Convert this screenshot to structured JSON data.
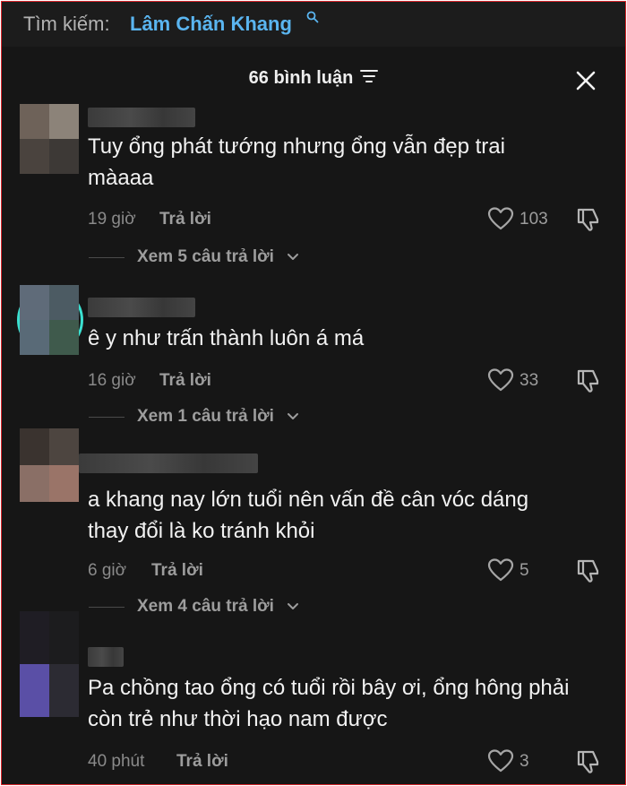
{
  "search": {
    "prefix": "Tìm kiếm:",
    "query": "Lâm Chấn Khang",
    "icon": "search-icon"
  },
  "header": {
    "title": "66 bình luận",
    "filter_icon": "filter-icon",
    "close_icon": "close-icon"
  },
  "colors": {
    "background": "#161616",
    "query": "#5ab5f0",
    "border": "#d9262c"
  },
  "comments": [
    {
      "text": "Tuy ổng phát tướng nhưng ổng vẫn đẹp trai màaaa",
      "time": "19 giờ",
      "reply_label": "Trả lời",
      "likes": "103",
      "replies_label": "Xem 5 câu trả lời"
    },
    {
      "text": "ê y như trấn thành luôn á má",
      "time": "16 giờ",
      "reply_label": "Trả lời",
      "likes": "33",
      "replies_label": "Xem 1 câu trả lời"
    },
    {
      "text": "a khang nay lớn tuổi nên vấn đề cân vóc dáng thay đổi là ko tránh khỏi",
      "time": "6 giờ",
      "reply_label": "Trả lời",
      "likes": "5",
      "replies_label": "Xem 4 câu trả lời"
    },
    {
      "text": "Pa chồng tao ổng có tuổi rồi bây ơi, ổng hông phải còn trẻ như thời hạo nam được",
      "time": "40 phút",
      "reply_label": "Trả lời",
      "likes": "3"
    }
  ]
}
